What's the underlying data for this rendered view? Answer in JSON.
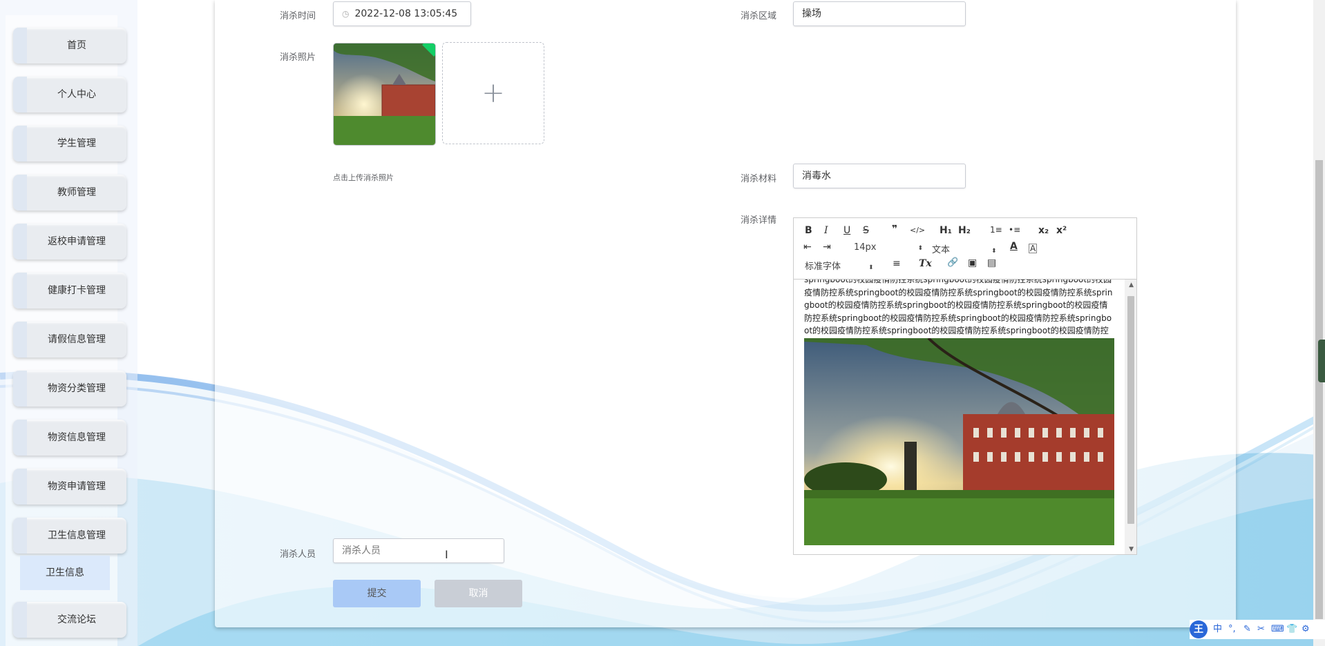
{
  "sidebar": {
    "items": [
      {
        "label": "首页"
      },
      {
        "label": "个人中心"
      },
      {
        "label": "学生管理"
      },
      {
        "label": "教师管理"
      },
      {
        "label": "返校申请管理"
      },
      {
        "label": "健康打卡管理"
      },
      {
        "label": "请假信息管理"
      },
      {
        "label": "物资分类管理"
      },
      {
        "label": "物资信息管理"
      },
      {
        "label": "物资申请管理"
      },
      {
        "label": "卫生信息管理"
      },
      {
        "label": "交流论坛"
      }
    ],
    "submenu": {
      "label": "卫生信息"
    }
  },
  "form": {
    "time": {
      "label": "消杀时间",
      "value": "2022-12-08 13:05:45"
    },
    "area": {
      "label": "消杀区域",
      "value": "操场"
    },
    "photo": {
      "label": "消杀照片",
      "hint": "点击上传消杀照片",
      "add_symbol": "+"
    },
    "material": {
      "label": "消杀材料",
      "value": "消毒水"
    },
    "detail": {
      "label": "消杀详情",
      "toolbar": {
        "bold": "B",
        "italic": "I",
        "underline": "U",
        "strike": "S",
        "quote": "❞",
        "code": "</>",
        "h1": "H₁",
        "h2": "H₂",
        "ordered_list": "1≡",
        "bullet_list": "•≡",
        "sub": "x₂",
        "sup": "x²",
        "outdent": "⇤",
        "indent": "⇥",
        "size": "14px",
        "header": "文本",
        "font": "标准字体",
        "color": "A",
        "background": "A",
        "align": "≡",
        "clean": "Tx",
        "link": "🔗",
        "image": "▣",
        "video": "▤"
      },
      "content_text": "springboot的校园疫情防控系统springboot的校园疫情防控系统springboot的校园疫情防控系统springboot的校园疫情防控系统springboot的校园疫情防控系统springboot的校园疫情防控系统springboot的校园疫情防控系统springboot的校园疫情防控系统springboot的校园疫情防控系统springboot的校园疫情防控系统springboot的校园疫情防控系统springboot的校园疫情防控系统springboot的校园疫情防控系统"
    },
    "staff": {
      "label": "消杀人员",
      "placeholder": "消杀人员"
    },
    "submit_label": "提交",
    "cancel_label": "取消"
  },
  "ime": {
    "logo": "王",
    "mode": "中",
    "punct": "°,",
    "icons": [
      "✎",
      "✂",
      "⌨",
      "👕",
      "⚙"
    ]
  },
  "colors": {
    "primary_light": "#a9c9f6",
    "menu_bg": "#e9ecf0",
    "accent_green": "#13ce66"
  }
}
